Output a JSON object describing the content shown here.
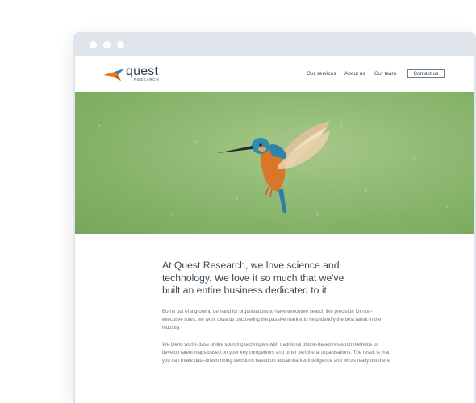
{
  "header": {
    "logo_word": "quest",
    "logo_sub": "RESEARCH",
    "nav": {
      "services": "Our services",
      "about": "About us",
      "team": "Our team",
      "contact": "Contact us"
    }
  },
  "content": {
    "headline": "At Quest Research, we love science and technology. We love it so much that we've built an entire business dedicated to it.",
    "paragraph1": "Borne out of a growing demand for organisations to have executive search like precision for non-executive roles, we work towards uncovering the passive market to help identify the best talent in the industry.",
    "paragraph2": "We blend world-class online sourcing techniques with traditional phone-based research methods to develop talent maps based on your key competitors and other peripheral organisations. The result is that you can make data-driven hiring decisions based on actual market intelligence and who's really out there."
  },
  "colors": {
    "logo_orange": "#e8791f",
    "logo_blue": "#2f7fb8",
    "text_dark": "#3c4a57",
    "text_body": "#6b7580",
    "hero_green": "#8cb870"
  },
  "icons": {
    "window_controls": [
      "window-dot-icon",
      "window-dot-icon",
      "window-dot-icon"
    ],
    "logo": "quest-bird-logo-icon"
  }
}
